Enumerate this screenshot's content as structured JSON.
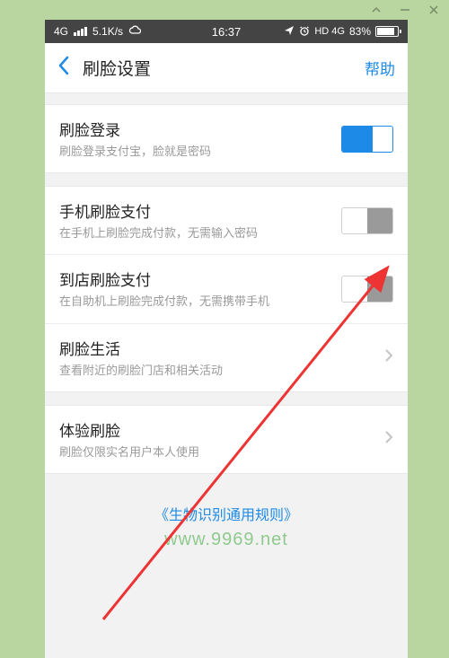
{
  "status": {
    "net_label": "4G",
    "speed": "5.1K/s",
    "time": "16:37",
    "hd4g": "HD 4G",
    "battery_pct": "83%"
  },
  "nav": {
    "title": "刷脸设置",
    "help": "帮助"
  },
  "rows": {
    "login": {
      "title": "刷脸登录",
      "subtitle": "刷脸登录支付宝，脸就是密码"
    },
    "phone_pay": {
      "title": "手机刷脸支付",
      "subtitle": "在手机上刷脸完成付款，无需输入密码"
    },
    "store_pay": {
      "title": "到店刷脸支付",
      "subtitle": "在自助机上刷脸完成付款，无需携带手机"
    },
    "life": {
      "title": "刷脸生活",
      "subtitle": "查看附近的刷脸门店和相关活动"
    },
    "experience": {
      "title": "体验刷脸",
      "subtitle": "刷脸仅限实名用户本人使用"
    }
  },
  "footer": {
    "link": "《生物识别通用规则》",
    "watermark": "www.9969.net"
  }
}
